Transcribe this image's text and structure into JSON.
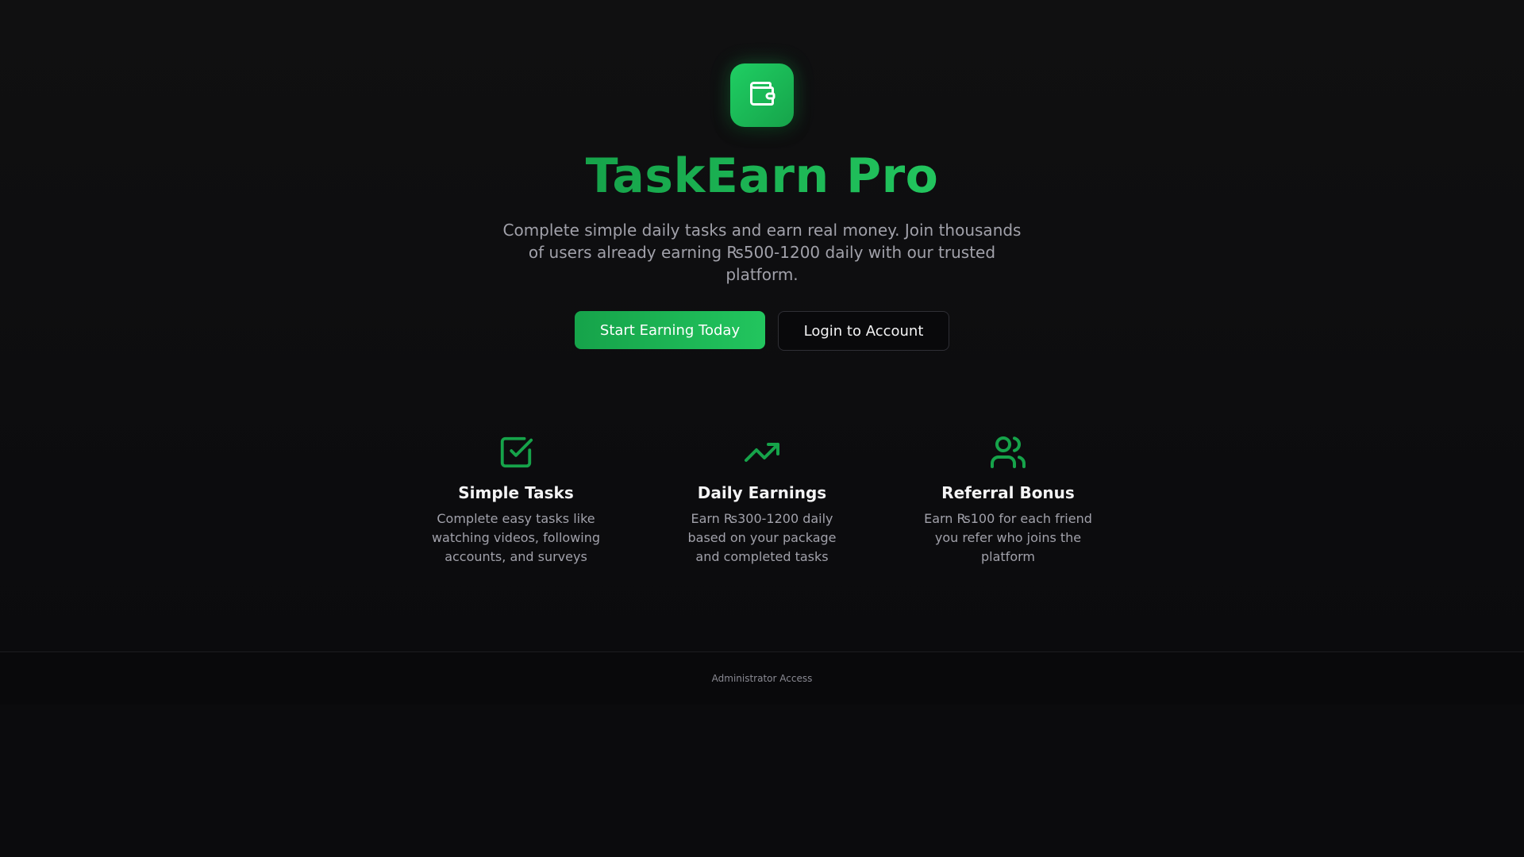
{
  "brand": {
    "logo_icon": "wallet-icon",
    "title": "TaskEarn Pro",
    "subtitle": "Complete simple daily tasks and earn real money. Join thousands of users already earning ₨500-1200 daily with our trusted platform."
  },
  "cta": {
    "primary_label": "Start Earning Today",
    "secondary_label": "Login to Account"
  },
  "features": [
    {
      "icon": "check-square-icon",
      "title": "Simple Tasks",
      "description": "Complete easy tasks like watching videos, following accounts, and surveys"
    },
    {
      "icon": "trending-up-icon",
      "title": "Daily Earnings",
      "description": "Earn ₨300-1200 daily based on your package and completed tasks"
    },
    {
      "icon": "users-icon",
      "title": "Referral Bonus",
      "description": "Earn ₨100 for each friend you refer who joins the platform"
    }
  ],
  "footer": {
    "admin_link": "Administrator Access"
  },
  "colors": {
    "background": "#0b0b0d",
    "accent": "#22c55e",
    "accent_dark": "#16a34a",
    "text_primary": "#f4f4f5",
    "text_muted": "#a1a1aa"
  }
}
